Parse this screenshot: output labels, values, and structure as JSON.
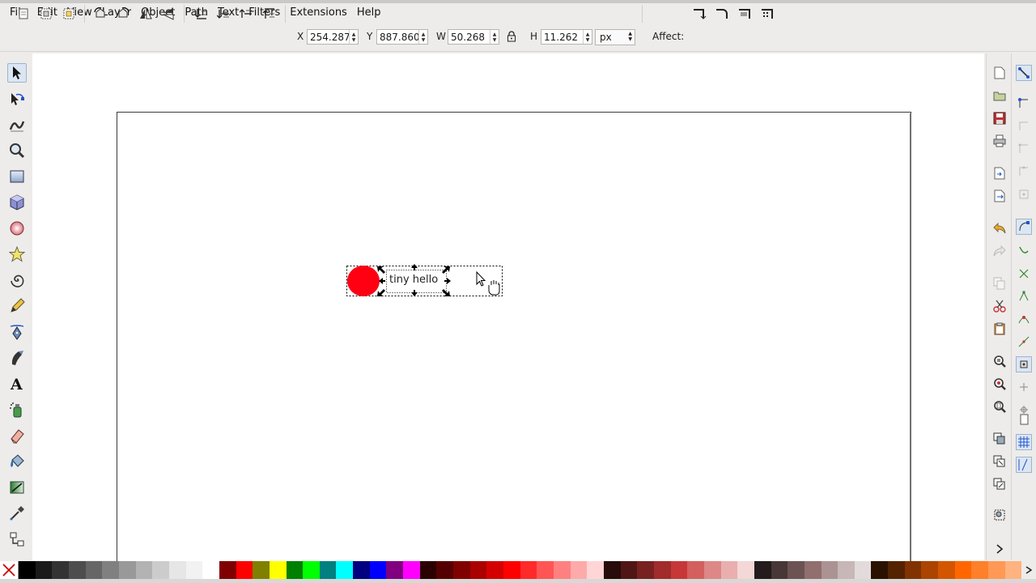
{
  "menu": [
    "File",
    "Edit",
    "View",
    "Layer",
    "Object",
    "Path",
    "Text",
    "Filters",
    "Extensions",
    "Help"
  ],
  "toolbar": {
    "x_label": "X",
    "x_value": "254.287",
    "y_label": "Y",
    "y_value": "887.860",
    "w_label": "W",
    "w_value": "50.268",
    "h_label": "H",
    "h_value": "11.262",
    "unit": "px",
    "affect_label": "Affect:"
  },
  "canvas": {
    "text_object": "tiny hello",
    "circle_color": "#ff0013"
  },
  "tools": [
    "selector-tool",
    "node-tool",
    "tweak-tool",
    "zoom-tool",
    "rectangle-tool",
    "3d-box-tool",
    "ellipse-tool",
    "star-tool",
    "spiral-tool",
    "pencil-tool",
    "pen-tool",
    "calligraphy-tool",
    "text-tool",
    "spray-tool",
    "eraser-tool",
    "paint-bucket-tool",
    "gradient-tool",
    "dropper-tool",
    "connector-tool"
  ],
  "palette": [
    "#000000",
    "#1a1a1a",
    "#333333",
    "#4d4d4d",
    "#666666",
    "#808080",
    "#999999",
    "#b3b3b3",
    "#cccccc",
    "#e6e6e6",
    "#f2f2f2",
    "#ffffff",
    "#800000",
    "#ff0000",
    "#808000",
    "#ffff00",
    "#008000",
    "#00ff00",
    "#008080",
    "#00ffff",
    "#000080",
    "#0000ff",
    "#800080",
    "#ff00ff",
    "#2b0000",
    "#550000",
    "#800000",
    "#aa0000",
    "#d40000",
    "#ff0000",
    "#ff2a2a",
    "#ff5555",
    "#ff8080",
    "#ffaaaa",
    "#ffd5d5",
    "#280b0b",
    "#501616",
    "#782121",
    "#a02c2c",
    "#c83737",
    "#d35f5f",
    "#de8787",
    "#e9afaf",
    "#f4d7d7",
    "#241c1c",
    "#483737",
    "#6c5353",
    "#916f6f",
    "#ac9393",
    "#c8b7b7",
    "#e3dbdb",
    "#2b1100",
    "#552200",
    "#803300",
    "#aa4400",
    "#d45500",
    "#ff6600",
    "#ff7f2a",
    "#ff9955",
    "#ffb380"
  ]
}
